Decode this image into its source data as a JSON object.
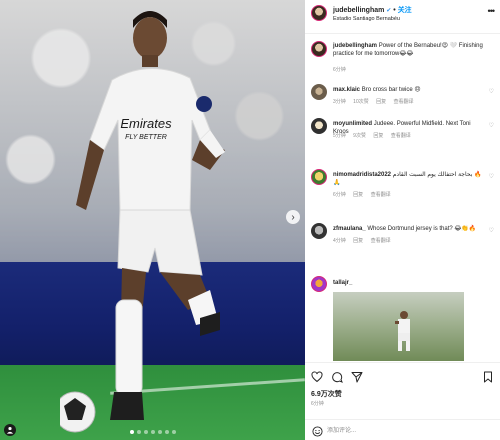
{
  "post": {
    "author": "judebellingham",
    "verified_mark": "✔",
    "separator": "•",
    "follow_label": "关注",
    "location": "Estadio Santiago Bernabéu",
    "caption": "Power of the Bernabeu!😍 🤍 Finishing practice for me tomorrow😂😂",
    "caption_age": "6分钟"
  },
  "comments": [
    {
      "user": "max.klaic",
      "text": "Bro cross bar twice 😠",
      "age": "3分钟",
      "likes": "10次赞",
      "reply": "回复",
      "translate": "查看翻译"
    },
    {
      "user": "moyunlimited",
      "text": "Judeee. Powerful Midfield. Next Toni Kroos",
      "age": "5分钟",
      "likes": "9次赞",
      "reply": "回复",
      "translate": "查看翻译"
    },
    {
      "user": "nimomadridista2022",
      "text": "بحاجة احتفالك يوم السبت القادم 🔥 🙏",
      "age": "6分钟",
      "likes": "",
      "reply": "回复",
      "translate": "查看翻译"
    },
    {
      "user": "zfmaulana_",
      "text": "Whose Dortmund jersey is that? 😂👏🔥",
      "age": "4分钟",
      "likes": "",
      "reply": "回复",
      "translate": "查看翻译"
    },
    {
      "user": "tallajr_",
      "text": "",
      "age": "",
      "likes": "",
      "reply": "",
      "translate": ""
    }
  ],
  "photo": {
    "shirt_sponsor": "Emirates",
    "shirt_slogan": "FLY BETTER",
    "next_arrow": "›",
    "page_dots": 7,
    "active_dot": 0
  },
  "actions": {
    "like_count": "6.9万次赞",
    "posted": "6分钟",
    "comment_placeholder": "添加评论..."
  },
  "icons": [
    "heart-icon",
    "comment-icon",
    "share-icon",
    "bookmark-icon",
    "smile-icon",
    "more-icon",
    "user-tag-icon",
    "chevron-right-icon"
  ],
  "colors": {
    "follow_blue": "#0095f6",
    "meta_gray": "#8e8e8e",
    "text": "#262626",
    "story_ring": "#d62976"
  }
}
